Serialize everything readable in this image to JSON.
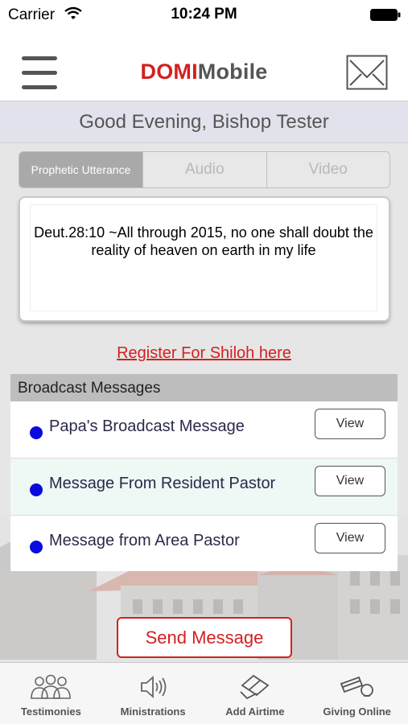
{
  "status_bar": {
    "carrier": "Carrier",
    "time": "10:24 PM"
  },
  "nav": {
    "brand_part1": "DOMI",
    "brand_part2": "Mobile"
  },
  "greeting": "Good Evening, Bishop Tester",
  "segments": [
    "Prophetic Utterance",
    "Audio",
    "Video"
  ],
  "utterance": "Deut.28:10  ~All through 2015, no one shall doubt the reality of heaven on earth in my life",
  "register_link": "Register For Shiloh here",
  "broadcast": {
    "header": "Broadcast Messages",
    "items": [
      {
        "title": "Papa's Broadcast Message",
        "button": "View"
      },
      {
        "title": "Message From Resident Pastor",
        "button": "View"
      },
      {
        "title": "Message from Area Pastor",
        "button": "View"
      }
    ]
  },
  "send_button": "Send Message",
  "tabs": [
    {
      "label": "Testimonies",
      "icon": "people-icon"
    },
    {
      "label": "Ministrations",
      "icon": "speaker-icon"
    },
    {
      "label": "Add Airtime",
      "icon": "phone-card-icon"
    },
    {
      "label": "Giving Online",
      "icon": "credit-card-icon"
    }
  ],
  "colors": {
    "brand_red": "#d42020",
    "bullet_blue": "#0a0adf",
    "header_gray": "#bdbdbd"
  }
}
